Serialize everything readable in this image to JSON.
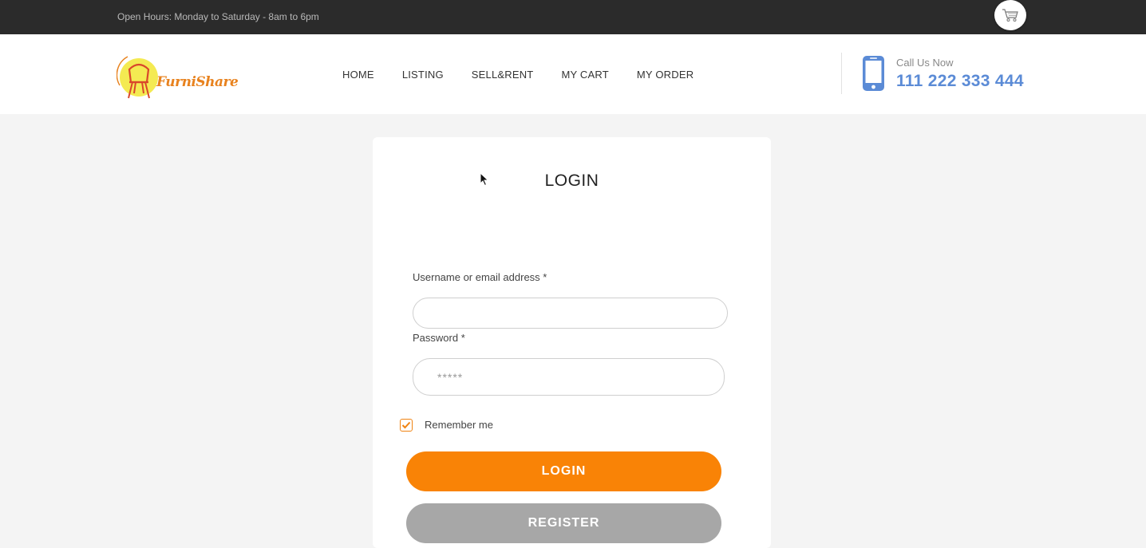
{
  "topbar": {
    "hours": "Open Hours: Monday to Saturday - 8am to 6pm",
    "cart_icon": "cart-icon"
  },
  "header": {
    "logo_text": "FurniShare",
    "nav": [
      {
        "label": "HOME"
      },
      {
        "label": "LISTING"
      },
      {
        "label": "SELL&RENT"
      },
      {
        "label": "MY CART"
      },
      {
        "label": "MY ORDER"
      }
    ],
    "call_label": "Call Us Now",
    "call_number": "111 222 333 444",
    "phone_icon": "phone-icon"
  },
  "login": {
    "title": "LOGIN",
    "username_label": "Username or email address *",
    "username_value": "",
    "password_label": "Password *",
    "password_placeholder": "*****",
    "remember_label": "Remember me",
    "remember_checked": true,
    "login_button": "LOGIN",
    "register_button": "REGISTER"
  },
  "colors": {
    "accent": "#f98306",
    "phone_blue": "#5b8bd6",
    "topbar": "#2b2b2b",
    "register_gray": "#a7a7a7"
  }
}
